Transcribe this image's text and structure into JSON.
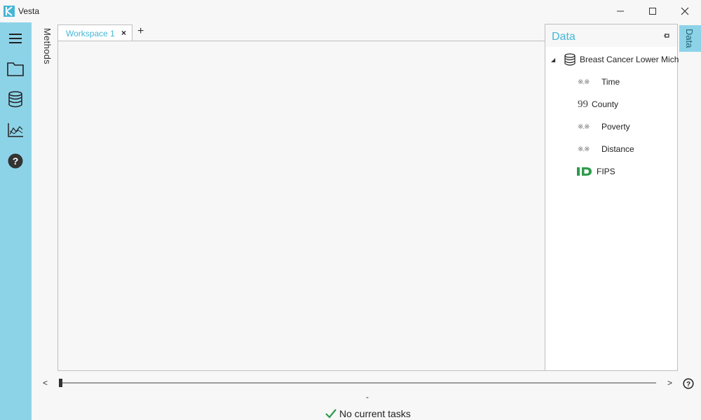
{
  "window": {
    "title": "Vesta",
    "minimize_label": "—",
    "maximize_label": "☐",
    "close_label": "✕"
  },
  "sidebar": {
    "items": [
      {
        "icon": "hamburger-menu-icon"
      },
      {
        "icon": "folder-icon"
      },
      {
        "icon": "database-icon"
      },
      {
        "icon": "chart-icon"
      },
      {
        "icon": "help-icon"
      }
    ]
  },
  "methods_panel": {
    "label": "Methods"
  },
  "tabs": {
    "items": [
      {
        "label": "Workspace 1",
        "close_label": "×"
      }
    ],
    "add_label": "+"
  },
  "data_panel": {
    "title": "Data",
    "side_tab_label": "Data",
    "dataset": {
      "name": "Breast Cancer Lower Mich",
      "icon": "database-icon",
      "fields": [
        {
          "name": "Time",
          "icon": "numeric-icon"
        },
        {
          "name": "County",
          "icon": "text-quote-icon"
        },
        {
          "name": "Poverty",
          "icon": "numeric-icon"
        },
        {
          "name": "Distance",
          "icon": "numeric-icon"
        },
        {
          "name": "FIPS",
          "icon": "id-icon"
        }
      ]
    }
  },
  "timeline": {
    "prev_label": "<",
    "next_label": ">",
    "position": 0
  },
  "status": {
    "dash": "-",
    "text": "No current tasks"
  },
  "colors": {
    "accent": "#46b6d6",
    "sidebar": "#8dd3e8",
    "id_green": "#2e9b4c"
  }
}
